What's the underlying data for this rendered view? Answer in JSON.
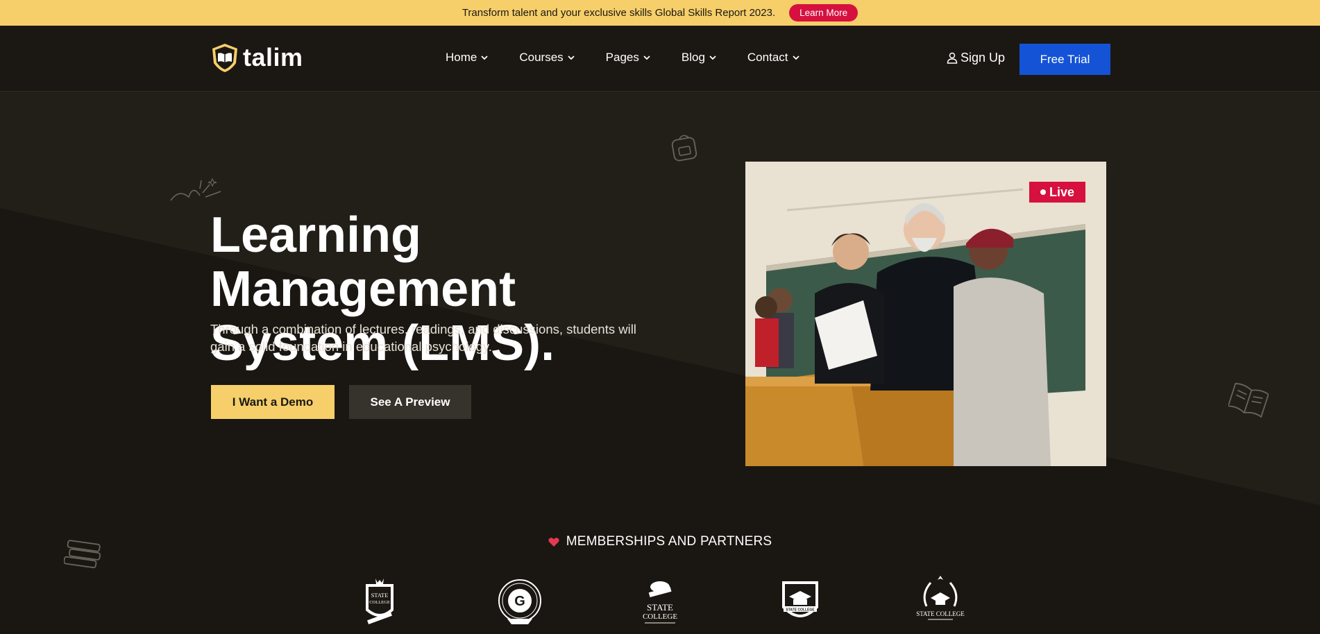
{
  "announcement": {
    "message": "Transform talent and your exclusive skills Global Skills Report 2023.",
    "cta_label": "Learn More"
  },
  "header": {
    "logo_text": "talim",
    "nav": [
      {
        "label": "Home"
      },
      {
        "label": "Courses"
      },
      {
        "label": "Pages"
      },
      {
        "label": "Blog"
      },
      {
        "label": "Contact"
      }
    ],
    "signup_label": "Sign Up",
    "trial_label": "Free Trial"
  },
  "hero": {
    "title_line1": "Learning Management",
    "title_line2": "System (LMS).",
    "description": "Through a combination of lectures, readings, and discussions, students will gain a solid foundation in educational psychology.",
    "demo_label": "I Want a Demo",
    "preview_label": "See A Preview",
    "live_badge": "Live"
  },
  "partners": {
    "title": "MEMBERSHIPS AND PARTNERS",
    "logos": [
      {
        "line1": "STATE",
        "line2": "COLLEGE"
      },
      {
        "line1": "G",
        "line2": ""
      },
      {
        "line1": "STATE",
        "line2": "COLLEGE"
      },
      {
        "line1": "STATE COLLEGE",
        "line2": ""
      },
      {
        "line1": "STATE COLLEGE",
        "line2": ""
      }
    ]
  },
  "colors": {
    "background": "#1b1813",
    "accent_yellow": "#f6cf6a",
    "accent_red": "#d6103f",
    "accent_blue": "#1453d6"
  }
}
